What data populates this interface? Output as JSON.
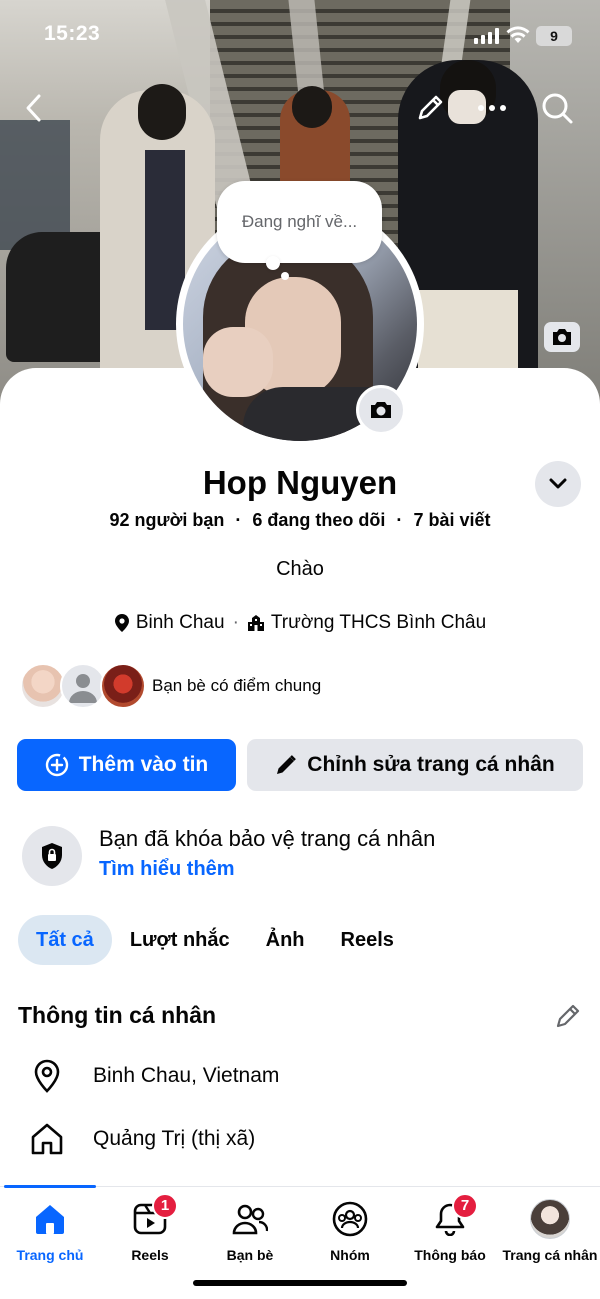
{
  "status_bar": {
    "time": "15:23",
    "battery": "9"
  },
  "profile": {
    "thinking_placeholder": "Đang nghĩ về...",
    "name": "Hop Nguyen",
    "friends": "92 người bạn",
    "following": "6 đang theo dõi",
    "posts": "7 bài viết",
    "stats_separator": "·",
    "bio": "Chào",
    "location": "Binh Chau",
    "school": "Trường THCS Bình Châu",
    "mutual_friends_label": "Bạn bè có điểm chung"
  },
  "actions": {
    "add_story": "Thêm vào tin",
    "edit_profile": "Chỉnh sửa trang cá nhân"
  },
  "lock_notice": {
    "title": "Bạn đã khóa bảo vệ trang cá nhân",
    "link": "Tìm hiểu thêm"
  },
  "tabs": [
    {
      "label": "Tất cả",
      "active": true
    },
    {
      "label": "Lượt nhắc",
      "active": false
    },
    {
      "label": "Ảnh",
      "active": false
    },
    {
      "label": "Reels",
      "active": false
    }
  ],
  "personal_info": {
    "title": "Thông tin cá nhân",
    "items": [
      {
        "icon": "location-pin-icon",
        "text": "Binh Chau, Vietnam"
      },
      {
        "icon": "home-icon",
        "text": "Quảng Trị (thị xã)"
      }
    ]
  },
  "bottom_nav": [
    {
      "label": "Trang chủ",
      "icon": "home-icon",
      "active": true
    },
    {
      "label": "Reels",
      "icon": "reels-icon",
      "badge": "1"
    },
    {
      "label": "Bạn bè",
      "icon": "friends-icon"
    },
    {
      "label": "Nhóm",
      "icon": "groups-icon"
    },
    {
      "label": "Thông báo",
      "icon": "bell-icon",
      "badge": "7"
    },
    {
      "label": "Trang cá nhân",
      "icon": "profile-avatar"
    }
  ],
  "colors": {
    "accent": "#0866ff",
    "badge": "#e41e3f",
    "secondary_button": "#e4e6eb",
    "active_tab_bg": "#dbe7f2"
  }
}
